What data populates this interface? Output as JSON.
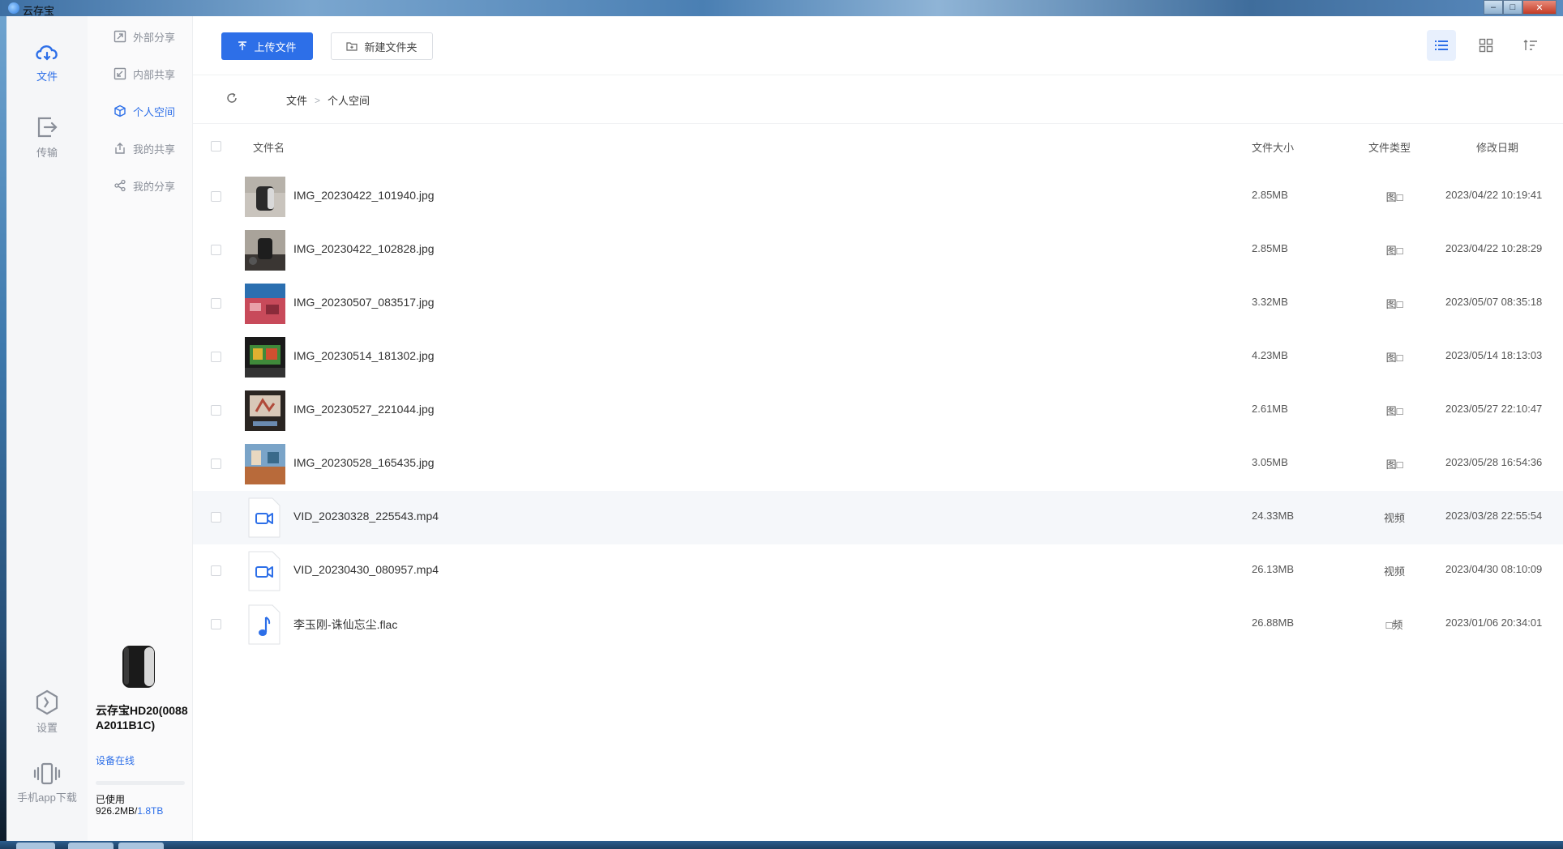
{
  "window": {
    "title": "云存宝",
    "min_glyph": "–",
    "max_glyph": "□",
    "close_glyph": "✕"
  },
  "rail": {
    "items": [
      {
        "label": "文件",
        "icon": "cloud-icon",
        "active": true
      },
      {
        "label": "传输",
        "icon": "transfer-icon",
        "active": false
      },
      {
        "label": "设置",
        "icon": "settings-icon",
        "active": false
      },
      {
        "label": "手机app下载",
        "icon": "phone-vibrate-icon",
        "active": false
      }
    ]
  },
  "subnav": {
    "items": [
      {
        "label": "外部分享",
        "icon": "external-share-icon",
        "active": false
      },
      {
        "label": "内部共享",
        "icon": "internal-share-icon",
        "active": false
      },
      {
        "label": "个人空间",
        "icon": "cube-icon",
        "active": true
      },
      {
        "label": "我的共享",
        "icon": "my-shared-icon",
        "active": false
      },
      {
        "label": "我的分享",
        "icon": "share-nodes-icon",
        "active": false
      }
    ]
  },
  "device": {
    "name": "云存宝HD20(0088A2011B1C)",
    "status": "设备在线",
    "usage_label": "已使用",
    "used": "926.2MB",
    "total": "1.8TB",
    "usage_fraction": 0.0005
  },
  "toolbar": {
    "upload_label": "上传文件",
    "new_folder_label": "新建文件夹"
  },
  "breadcrumb": {
    "root": "文件",
    "current": "个人空间"
  },
  "table": {
    "headers": {
      "name": "文件名",
      "size": "文件大小",
      "type": "文件类型",
      "date": "修改日期"
    },
    "rows": [
      {
        "name": "IMG_20230422_101940.jpg",
        "size": "2.85MB",
        "type": "图□",
        "date": "2023/04/22 10:19:41",
        "kind": "image"
      },
      {
        "name": "IMG_20230422_102828.jpg",
        "size": "2.85MB",
        "type": "图□",
        "date": "2023/04/22 10:28:29",
        "kind": "image"
      },
      {
        "name": "IMG_20230507_083517.jpg",
        "size": "3.32MB",
        "type": "图□",
        "date": "2023/05/07 08:35:18",
        "kind": "image"
      },
      {
        "name": "IMG_20230514_181302.jpg",
        "size": "4.23MB",
        "type": "图□",
        "date": "2023/05/14 18:13:03",
        "kind": "image"
      },
      {
        "name": "IMG_20230527_221044.jpg",
        "size": "2.61MB",
        "type": "图□",
        "date": "2023/05/27 22:10:47",
        "kind": "image"
      },
      {
        "name": "IMG_20230528_165435.jpg",
        "size": "3.05MB",
        "type": "图□",
        "date": "2023/05/28 16:54:36",
        "kind": "image"
      },
      {
        "name": "VID_20230328_225543.mp4",
        "size": "24.33MB",
        "type": "视频",
        "date": "2023/03/28 22:55:54",
        "kind": "video"
      },
      {
        "name": "VID_20230430_080957.mp4",
        "size": "26.13MB",
        "type": "视频",
        "date": "2023/04/30 08:10:09",
        "kind": "video"
      },
      {
        "name": "李玉刚-诛仙忘尘.flac",
        "size": "26.88MB",
        "type": "□频",
        "date": "2023/01/06 20:34:01",
        "kind": "audio"
      }
    ]
  },
  "colors": {
    "accent": "#2d6fe8",
    "rail_bg": "#f5f6f8",
    "hover_row": "#f5f7fa"
  }
}
